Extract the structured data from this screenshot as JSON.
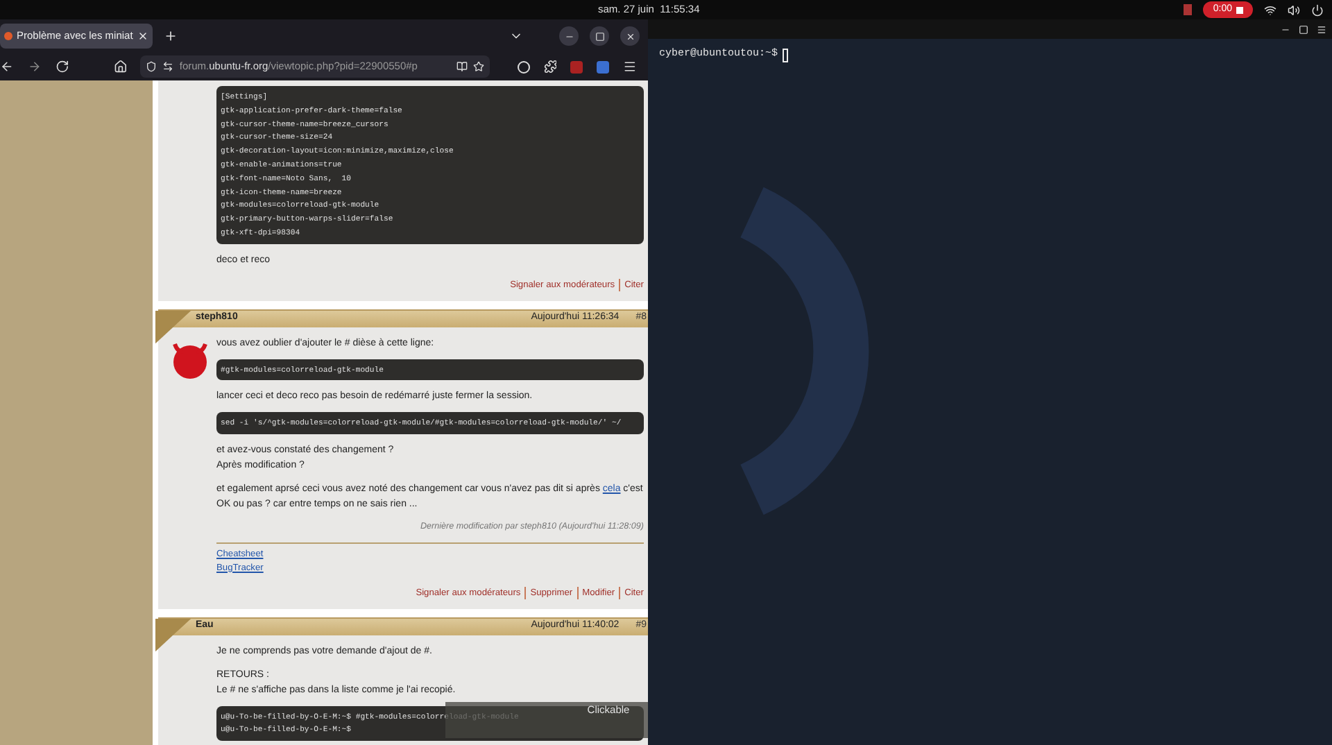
{
  "top_bar": {
    "date_time": "sam. 27 juin  11:55:34",
    "recording_time": "0:00"
  },
  "browser": {
    "tab_title": "Problème avec les miniat",
    "url": {
      "prefix": "forum.",
      "host": "ubuntu-fr.org",
      "path": "/viewtopic.php?pid=22900550#p"
    }
  },
  "posts": [
    {
      "blocks": [
        {
          "kind": "code",
          "lines": [
            "[Settings]",
            "gtk-application-prefer-dark-theme=false",
            "gtk-cursor-theme-name=breeze_cursors",
            "gtk-cursor-theme-size=24",
            "gtk-decoration-layout=icon:minimize,maximize,close",
            "gtk-enable-animations=true",
            "gtk-font-name=Noto Sans,  10",
            "gtk-icon-theme-name=breeze",
            "gtk-modules=colorreload-gtk-module",
            "gtk-primary-button-warps-slider=false",
            "gtk-xft-dpi=98304"
          ]
        },
        {
          "kind": "text",
          "lines": [
            "deco et reco"
          ]
        }
      ],
      "actions": [
        "Signaler aux modérateurs",
        "Citer"
      ]
    },
    {
      "author": "steph810",
      "date": "Aujourd'hui 11:26:34",
      "number": "#8",
      "avatar": true,
      "blocks": [
        {
          "kind": "text",
          "lines": [
            "vous avez oublier d'ajouter le # dièse à cette ligne:"
          ]
        },
        {
          "kind": "code",
          "lines": [
            "#gtk-modules=colorreload-gtk-module"
          ]
        },
        {
          "kind": "text",
          "lines": [
            "lancer ceci et deco reco pas besoin de redémarré juste fermer la session."
          ]
        },
        {
          "kind": "code",
          "lines": [
            "sed -i 's/^gtk-modules=colorreload-gtk-module/#gtk-modules=colorreload-gtk-module/' ~/"
          ]
        },
        {
          "kind": "text",
          "lines": [
            "et avez-vous constaté des changement ?",
            "Après modification ?"
          ]
        },
        {
          "kind": "link_text",
          "before": "et egalement aprsé ceci vous avez noté des changement car vous n'avez pas dit si après ",
          "link": "cela",
          "after": " c'est OK ou pas ? car entre temps on ne sais rien ..."
        }
      ],
      "edit_note": "Dernière modification par steph810 (Aujourd'hui 11:28:09)",
      "signature_links": [
        "Cheatsheet",
        "BugTracker"
      ],
      "actions": [
        "Signaler aux modérateurs",
        "Supprimer",
        "Modifier",
        "Citer"
      ]
    },
    {
      "author": "Eau",
      "date": "Aujourd'hui 11:40:02",
      "number": "#9",
      "avatar": false,
      "blocks": [
        {
          "kind": "text",
          "lines": [
            "Je ne comprends pas votre demande d'ajout de #."
          ]
        },
        {
          "kind": "text",
          "lines": [
            "RETOURS :",
            "Le # ne s'affiche pas dans la liste comme je l'ai recopié."
          ]
        },
        {
          "kind": "code",
          "lines": [
            "u@u-To-be-filled-by-O-E-M:~$ #gtk-modules=colorreload-gtk-module",
            "u@u-To-be-filled-by-O-E-M:~$"
          ]
        }
      ]
    }
  ],
  "tooltip": {
    "text": "Clickable"
  },
  "terminal": {
    "prompt": "cyber@ubuntoutou:~$"
  }
}
